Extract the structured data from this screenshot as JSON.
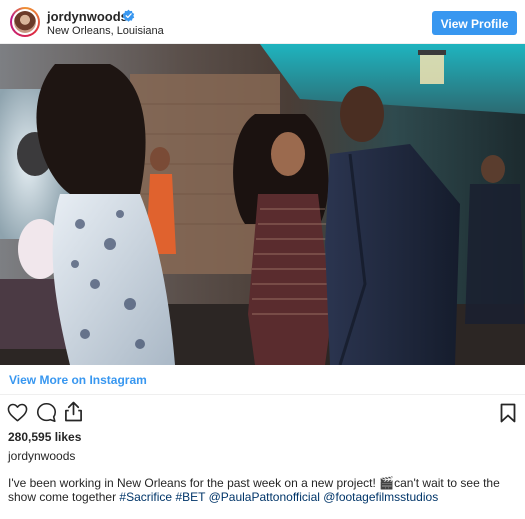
{
  "header": {
    "username": "jordynwoods",
    "location": "New Orleans, Louisiana",
    "view_profile_label": "View Profile"
  },
  "media": {
    "icon": "photo"
  },
  "view_more_label": "View More on Instagram",
  "actions": {
    "like_icon": "heart-icon",
    "comment_icon": "comment-icon",
    "share_icon": "share-icon",
    "save_icon": "bookmark-icon"
  },
  "likes": "280,595 likes",
  "poster": "jordynwoods",
  "caption": {
    "text": "I've been working in New Orleans for the past week on a new project! 🎬can't wait to see the show come together",
    "tag_sacrifice": "#Sacrifice",
    "tag_bet": "#BET",
    "mention_paula": "@PaulaPattonofficial",
    "mention_footage": "@footagefilmsstudios"
  },
  "colors": {
    "accent": "#3897f0",
    "link": "#003569",
    "verified": "#3897f0"
  }
}
